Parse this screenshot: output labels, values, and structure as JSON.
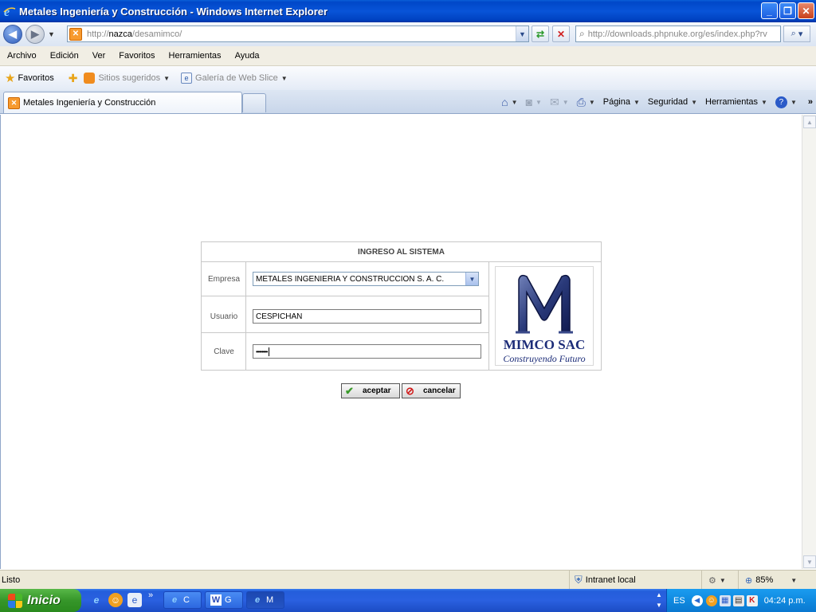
{
  "window": {
    "title": "Metales Ingeniería y Construcción - Windows Internet Explorer"
  },
  "addressbar": {
    "url_prefix": "http://",
    "url_host": "nazca",
    "url_path": "/desamimco/",
    "search_text": "http://downloads.phpnuke.org/es/index.php?rv"
  },
  "menu": {
    "items": [
      "Archivo",
      "Edición",
      "Ver",
      "Favoritos",
      "Herramientas",
      "Ayuda"
    ]
  },
  "favorites_bar": {
    "favorites_label": "Favoritos",
    "suggested_label": "Sitios sugeridos",
    "gallery_label": "Galería de Web Slice"
  },
  "tabs": {
    "active_label": "Metales Ingeniería y Construcción"
  },
  "command_bar": {
    "page_label": "Página",
    "security_label": "Seguridad",
    "tools_label": "Herramientas",
    "more": "»"
  },
  "login": {
    "heading": "INGRESO AL SISTEMA",
    "company_label": "Empresa",
    "company_value": "METALES INGENIERIA Y CONSTRUCCION S. A. C.",
    "user_label": "Usuario",
    "user_value": "CESPICHAN",
    "password_label": "Clave",
    "password_value": "••••••••",
    "logo_brand": "MIMCO SAC",
    "logo_tagline": "Construyendo Futuro",
    "accept_label": "aceptar",
    "cancel_label": "cancelar"
  },
  "statusbar": {
    "status": "Listo",
    "zone": "Intranet local",
    "zoom": "85%"
  },
  "taskbar": {
    "start_label": "Inicio",
    "buttons": [
      "C",
      "G",
      "M"
    ],
    "lang": "ES",
    "clock": "04:24 p.m."
  },
  "colors": {
    "titlebar": "#0854d8",
    "logo_blue": "#1c2c78",
    "start_green": "#36962a"
  }
}
